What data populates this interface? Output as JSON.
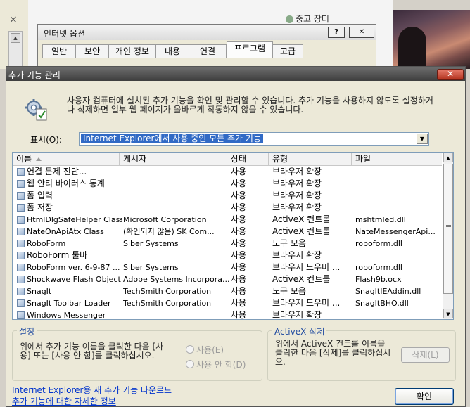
{
  "background": {
    "close_glyph": "×",
    "market_label": "중고 장터",
    "internet_options": {
      "title": "인터넷 옵션",
      "help_btn": "?",
      "close_btn": "✕",
      "tabs": [
        "일반",
        "보안",
        "개인 정보",
        "내용",
        "연결",
        "프로그램",
        "고급"
      ],
      "active_tab": "프로그램"
    }
  },
  "dialog": {
    "title": "추가 기능 관리",
    "close_btn": "✕",
    "description": "사용자 컴퓨터에 설치된 추가 기능을 확인 및 관리할 수 있습니다. 추가 기능을 사용하지 않도록 설정하거나 삭제하면 일부 웹 페이지가 올바르게 작동하지 않을 수 있습니다.",
    "show_label": "표시(O):",
    "show_value": "Internet Explorer에서 사용 중인 모든 추가 기능",
    "columns": [
      "이름",
      "게시자",
      "상태",
      "유형",
      "파일"
    ],
    "rows": [
      [
        "연결 문제 진단...",
        "",
        "사용",
        "브라우저 확장",
        ""
      ],
      [
        "웹 안티 바이러스 통계",
        "",
        "사용",
        "브라우저 확장",
        ""
      ],
      [
        "폼 입력",
        "",
        "사용",
        "브라우저 확장",
        ""
      ],
      [
        "폼 저장",
        "",
        "사용",
        "브라우저 확장",
        ""
      ],
      [
        "HtmlDlgSafeHelper Class",
        "Microsoft Corporation",
        "사용",
        "ActiveX 컨트롤",
        "mshtmled.dll"
      ],
      [
        "NateOnApiAtx Class",
        "(확인되지 않음) SK Com...",
        "사용",
        "ActiveX 컨트롤",
        "NateMessengerApi..."
      ],
      [
        "RoboForm",
        "Siber Systems",
        "사용",
        "도구 모음",
        "roboform.dll"
      ],
      [
        "RoboForm 툴바",
        "",
        "사용",
        "브라우저 확장",
        ""
      ],
      [
        "RoboForm ver. 6-9-87 ...",
        "Siber Systems",
        "사용",
        "브라우저 도우미 ...",
        "roboform.dll"
      ],
      [
        "Shockwave Flash Object",
        "Adobe Systems Incorpora...",
        "사용",
        "ActiveX 컨트롤",
        "Flash9b.ocx"
      ],
      [
        "SnagIt",
        "TechSmith Corporation",
        "사용",
        "도구 모음",
        "SnagItIEAddin.dll"
      ],
      [
        "SnagIt Toolbar Loader",
        "TechSmith Corporation",
        "사용",
        "브라우저 도우미 ...",
        "SnagItBHO.dll"
      ],
      [
        "Windows Messenger",
        "",
        "사용",
        "브라우저 확장",
        ""
      ]
    ],
    "settings_group": {
      "label": "설정",
      "text": "위에서 추가 기능 이름을 클릭한 다음 [사용] 또는 [사용 안 함]를 클릭하십시오.",
      "radio_enable": "사용(E)",
      "radio_disable": "사용 안 함(D)"
    },
    "activex_group": {
      "label": "ActiveX 삭제",
      "text": "위에서 ActiveX 컨트롤 이름을 클릭한 다음 [삭제]를 클릭하십시오.",
      "delete_btn": "삭제(L)"
    },
    "download_link": "Internet Explorer용 새 추가 기능 다운로드",
    "more_link": "추가 기능에 대한 자세한 정보",
    "ok_btn": "확인"
  }
}
